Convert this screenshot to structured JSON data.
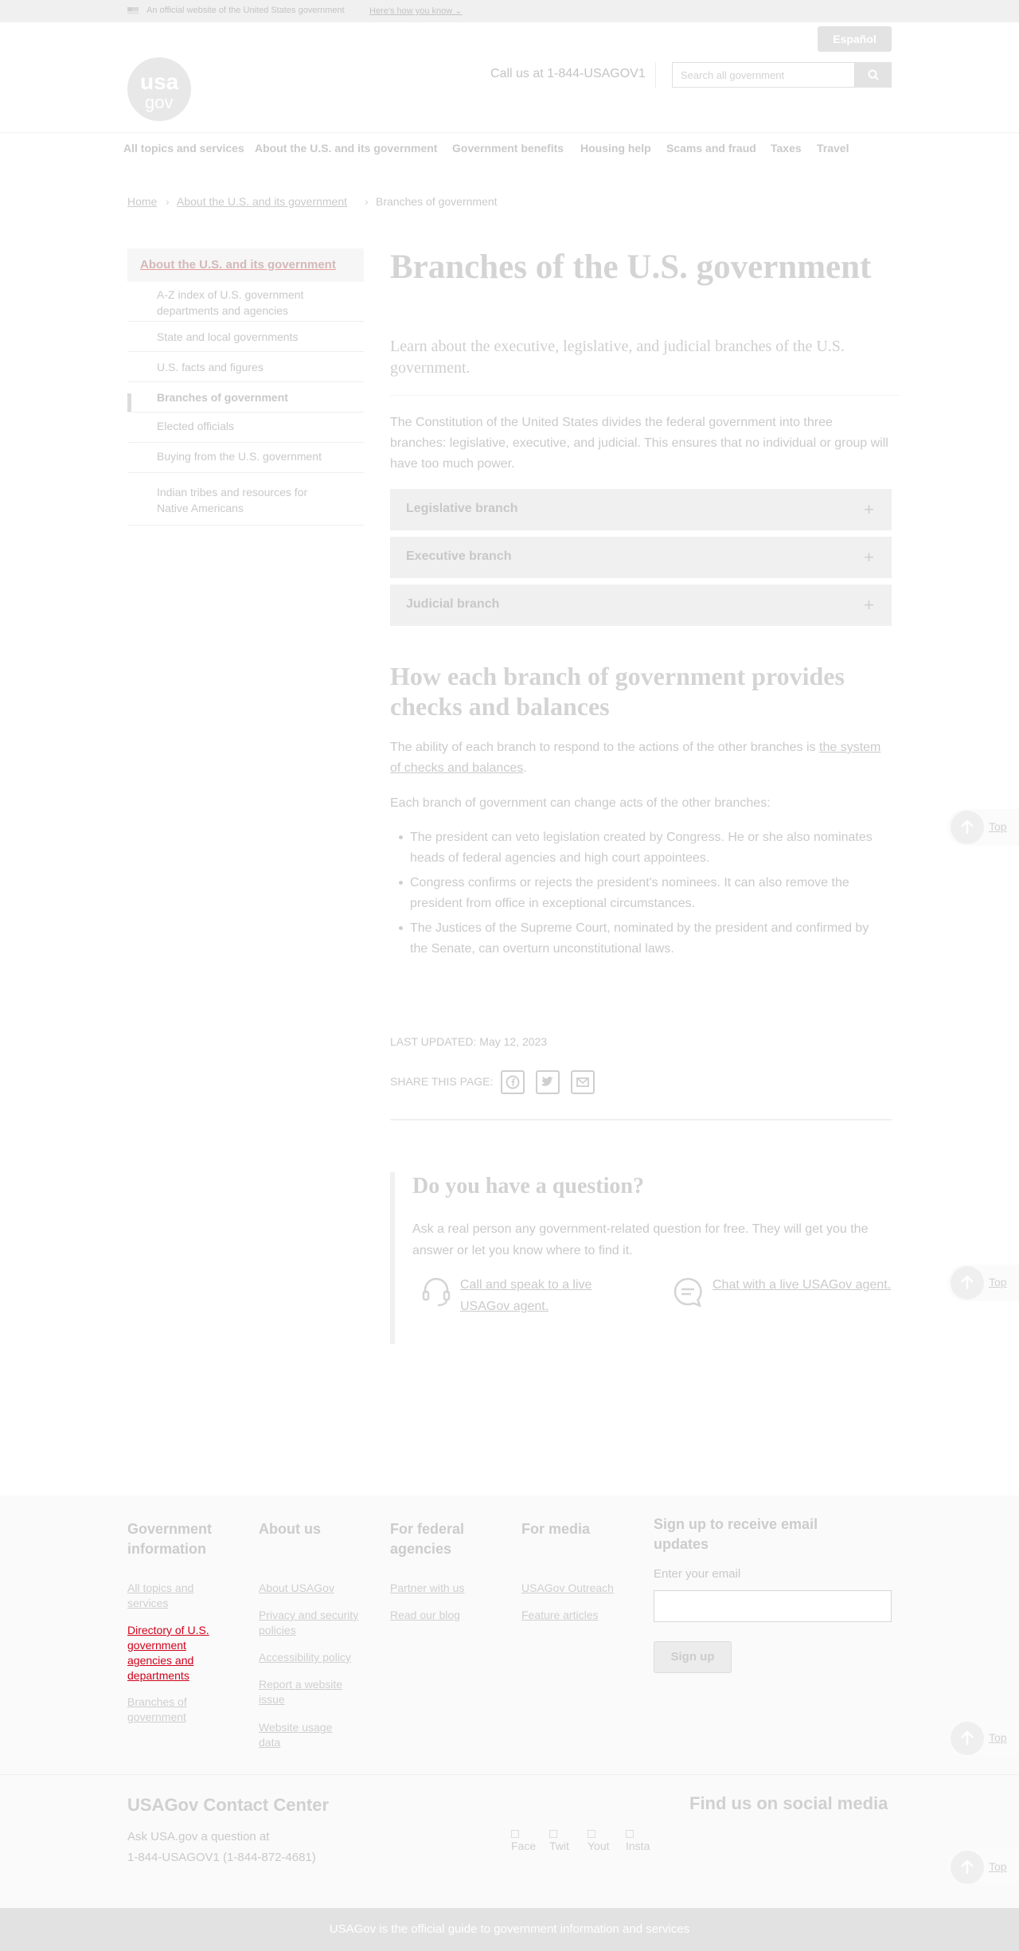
{
  "banner": {
    "official_text": "An official website of the United States government",
    "know_link": "Here's how you know ⌄"
  },
  "header": {
    "espanol_label": "Español",
    "logo_top": "usa",
    "logo_bottom": "gov",
    "call_us": "Call us at 1-844-USAGOV1",
    "search_placeholder": "Search all government"
  },
  "nav": {
    "items": [
      {
        "label": "All topics and services"
      },
      {
        "label": "About the U.S. and its government"
      },
      {
        "label": "Government benefits"
      },
      {
        "label": "Housing help"
      },
      {
        "label": "Scams and fraud"
      },
      {
        "label": "Taxes"
      },
      {
        "label": "Travel"
      }
    ]
  },
  "breadcrumb": {
    "items": [
      "Home",
      "About the U.S. and its government",
      "Branches of government"
    ],
    "separator": "›"
  },
  "sidebar": {
    "heading": "About the U.S. and its government",
    "items": [
      {
        "label": "A-Z index of U.S. government departments and agencies"
      },
      {
        "label": "State and local governments"
      },
      {
        "label": "U.S. facts and figures"
      },
      {
        "label": "Branches of government",
        "active": true
      },
      {
        "label": "Elected officials"
      },
      {
        "label": "Buying from the U.S. government"
      },
      {
        "label": "Indian tribes and resources for Native Americans"
      }
    ]
  },
  "main": {
    "title": "Branches of the U.S. government",
    "lead": "Learn about the executive, legislative, and judicial branches of the U.S. government.",
    "intro": "The Constitution of the United States divides the federal government into three branches: legislative, executive, and judicial. This ensures that no individual or group will have too much power.",
    "accordions": [
      {
        "label": "Legislative branch",
        "icon": "+"
      },
      {
        "label": "Executive branch",
        "icon": "+"
      },
      {
        "label": "Judicial branch",
        "icon": "+"
      }
    ],
    "checks_title": "How each branch of government provides checks and balances",
    "checks_p1_start": "The ability of each branch to respond to the actions of the other branches is ",
    "checks_p1_link": "the system of checks and balances",
    "checks_p1_end": ".",
    "checks_p2": "Each branch of government can change acts of the other branches:",
    "checks_list": [
      "The president can veto legislation created by Congress. He or she also nominates heads of federal agencies and high court appointees.",
      "Congress confirms or rejects the president's nominees. It can also remove the president from office in exceptional circumstances.",
      "The Justices of the Supreme Court, nominated by the president and confirmed by the Senate, can overturn unconstitutional laws."
    ],
    "last_updated": "LAST UPDATED: May 12, 2023",
    "share_label": "SHARE THIS PAGE:"
  },
  "question": {
    "title": "Do you have a question?",
    "text": "Ask a real person any government-related question for free. They will get you the answer or let you know where to find it.",
    "call_link": "Call and speak to a live USAGov agent.",
    "chat_link": "Chat with a live USAGov agent."
  },
  "top_label": "Top",
  "footer": {
    "columns": [
      {
        "heading": "Government information",
        "links": [
          "All topics and services",
          "Directory of U.S. government agencies and departments",
          "Branches of government"
        ]
      },
      {
        "heading": "About us",
        "links": [
          "About USAGov",
          "Privacy and security policies",
          "Accessibility policy",
          "Report a website issue",
          "Website usage data"
        ]
      },
      {
        "heading": "For federal agencies",
        "links": [
          "Partner with us",
          "Read our blog"
        ]
      },
      {
        "heading": "For media",
        "links": [
          "USAGov Outreach",
          "Feature articles"
        ]
      }
    ],
    "signup_heading": "Sign up to receive email updates",
    "email_label": "Enter your email",
    "signup_button": "Sign up",
    "contact_title": "USAGov Contact Center",
    "contact_line1": "Ask USA.gov a question at",
    "contact_line2": "1-844-USAGOV1 (1-844-872-4681)",
    "social_title": "Find us on social media",
    "social": [
      "Face",
      "Twit",
      "Yout",
      "Insta"
    ],
    "tagline": "USAGov is the official guide to government information and services"
  },
  "colors": {
    "highlight_link": "#d0021b",
    "sidebar_heading_underline": "#e89a9a"
  }
}
